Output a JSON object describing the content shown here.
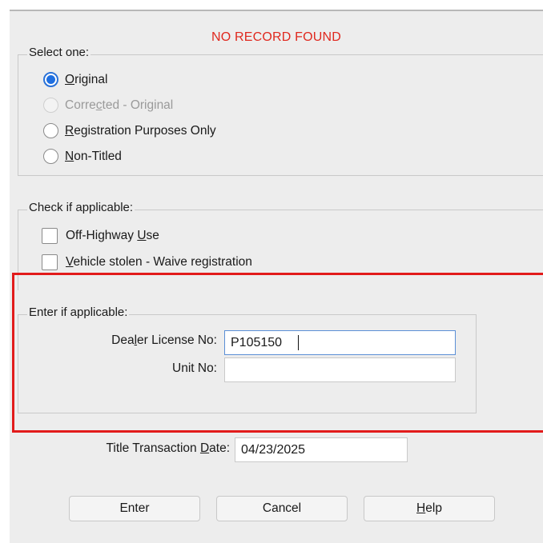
{
  "dialog": {
    "title": "NO RECORD FOUND"
  },
  "select_one": {
    "legend": "Select one:",
    "options": [
      {
        "pre": "",
        "u": "O",
        "post": "riginal",
        "selected": true,
        "disabled": false
      },
      {
        "pre": "Corre",
        "u": "c",
        "post": "ted - Original",
        "selected": false,
        "disabled": true
      },
      {
        "pre": "",
        "u": "R",
        "post": "egistration Purposes Only",
        "selected": false,
        "disabled": false
      },
      {
        "pre": "",
        "u": "N",
        "post": "on-Titled",
        "selected": false,
        "disabled": false
      }
    ]
  },
  "check_applicable": {
    "legend": "Check if applicable:",
    "items": [
      {
        "pre": "Off-Highway ",
        "u": "U",
        "post": "se",
        "checked": false
      },
      {
        "pre": "",
        "u": "V",
        "post": "ehicle stolen - Waive registration",
        "checked": false
      }
    ]
  },
  "enter_applicable": {
    "legend": "Enter if applicable:",
    "dealer_label_pre": "Dea",
    "dealer_label_u": "l",
    "dealer_label_post": "er License No:",
    "dealer_value": "P105150",
    "unit_label": "Unit No:",
    "unit_value": ""
  },
  "title_date": {
    "label_pre": "Title Transaction ",
    "label_u": "D",
    "label_post": "ate:",
    "value": "04/23/2025"
  },
  "buttons": {
    "enter": "Enter",
    "cancel": "Cancel",
    "help_u": "H",
    "help_post": "elp"
  },
  "colors": {
    "title_red": "#e0281e",
    "highlight_red": "#e21b1b",
    "radio_blue": "#1f6fe0"
  }
}
